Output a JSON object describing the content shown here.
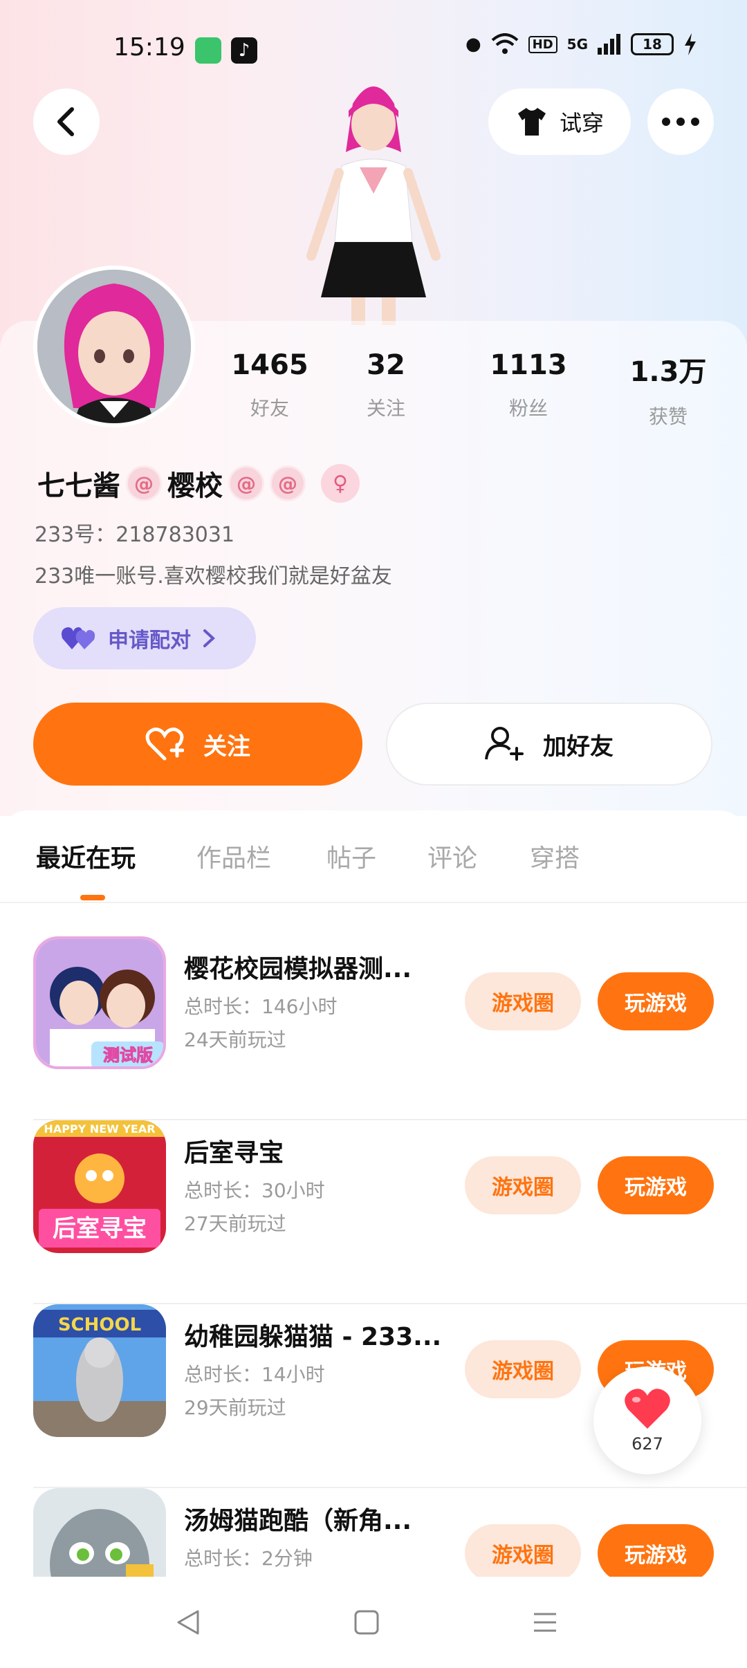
{
  "status_bar": {
    "time": "15:19",
    "network": "5G",
    "hd_badge": "HD",
    "battery": "18"
  },
  "header": {
    "tryon_label": "试穿"
  },
  "profile": {
    "stats": [
      {
        "value": "1465",
        "label": "好友"
      },
      {
        "value": "32",
        "label": "关注"
      },
      {
        "value": "1113",
        "label": "粉丝"
      },
      {
        "value": "1.3万",
        "label": "获赞"
      }
    ],
    "nickname_part1": "七七酱",
    "nickname_part2": "樱校",
    "uid": "233号：218783031",
    "bio": "233唯一账号.喜欢樱校我们就是好盆友",
    "pair_label": "申请配对"
  },
  "actions": {
    "follow_label": "关注",
    "add_friend_label": "加好友"
  },
  "tabs": [
    "最近在玩",
    "作品栏",
    "帖子",
    "评论",
    "穿搭"
  ],
  "games": [
    {
      "title": "樱花校园模拟器测...",
      "duration": "总时长：146小时",
      "last_played": "24天前玩过",
      "circle_label": "游戏圈",
      "play_label": "玩游戏",
      "icon_text": "测试版"
    },
    {
      "title": "后室寻宝",
      "duration": "总时长：30小时",
      "last_played": "27天前玩过",
      "circle_label": "游戏圈",
      "play_label": "玩游戏",
      "icon_text": "后室寻宝",
      "icon_banner": "HAPPY NEW YEAR"
    },
    {
      "title": "幼稚园躲猫猫 - 233...",
      "duration": "总时长：14小时",
      "last_played": "29天前玩过",
      "circle_label": "游戏圈",
      "play_label": "玩游戏",
      "icon_text": "SCHOOL"
    },
    {
      "title": "汤姆猫跑酷（新角...",
      "duration": "总时长：2分钟",
      "last_played": "",
      "circle_label": "游戏圈",
      "play_label": "玩游戏"
    }
  ],
  "like_float": {
    "count": "627"
  },
  "colors": {
    "accent": "#ff7410",
    "accent_light": "#fde6da",
    "pair_bg": "#e3defa",
    "pair_text": "#6558c9"
  }
}
